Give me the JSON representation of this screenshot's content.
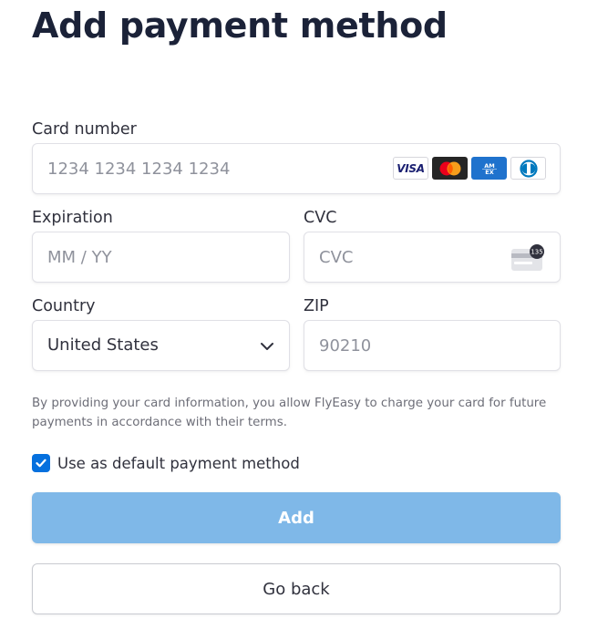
{
  "page": {
    "title": "Add payment method"
  },
  "card_number": {
    "label": "Card number",
    "placeholder": "1234 1234 1234 1234",
    "brands": [
      {
        "name": "visa-icon",
        "text": "VISA",
        "color": "#1a1f71"
      },
      {
        "name": "mastercard-icon",
        "colors": [
          "#eb001b",
          "#f79e1b"
        ]
      },
      {
        "name": "amex-icon",
        "text": "AMEX",
        "color": "#1f72cd"
      },
      {
        "name": "diners-club-icon",
        "color": "#0079be"
      }
    ]
  },
  "expiration": {
    "label": "Expiration",
    "placeholder": "MM / YY"
  },
  "cvc": {
    "label": "CVC",
    "placeholder": "CVC",
    "icon": "cvc-card-icon",
    "icon_badge": "135"
  },
  "country": {
    "label": "Country",
    "value": "United States",
    "icon": "chevron-down-icon"
  },
  "zip": {
    "label": "ZIP",
    "placeholder": "90210"
  },
  "terms": {
    "text": "By providing your card information, you allow FlyEasy to charge your card for future payments in accordance with their terms."
  },
  "default_checkbox": {
    "label": "Use as default payment method",
    "checked": true
  },
  "buttons": {
    "add_label": "Add",
    "back_label": "Go back"
  },
  "colors": {
    "accent": "#0570de",
    "add_button_disabled": "#7fb8e8",
    "title": "#1b2238"
  }
}
